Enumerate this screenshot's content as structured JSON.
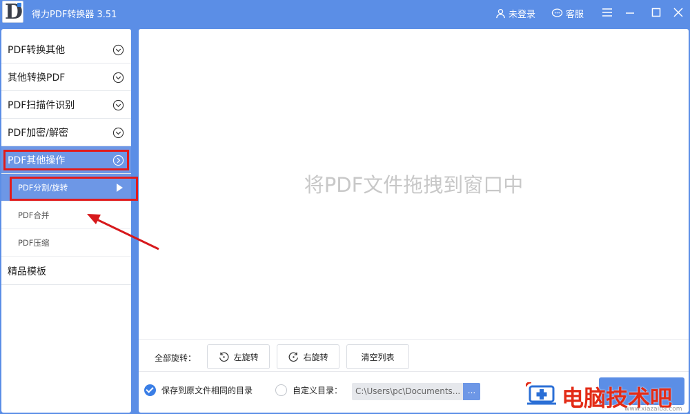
{
  "window": {
    "title": "得力PDF转换器 3.51",
    "login_label": "未登录",
    "service_label": "客服"
  },
  "icons": {
    "logo": "app-logo-icon",
    "user": "user-icon",
    "chat": "chat-icon",
    "menu": "hamburger-menu-icon",
    "minimize": "minimize-icon",
    "maximize": "maximize-icon",
    "close": "close-icon"
  },
  "sidebar": {
    "items": [
      {
        "label": "PDF转换其他"
      },
      {
        "label": "其他转换PDF"
      },
      {
        "label": "PDF扫描件识别"
      },
      {
        "label": "PDF加密/解密"
      },
      {
        "label": "PDF其他操作"
      },
      {
        "label": "精品模板"
      }
    ],
    "sub_items": [
      {
        "label": "PDF分割/旋转"
      },
      {
        "label": "PDF合并"
      },
      {
        "label": "PDF压缩"
      }
    ]
  },
  "main": {
    "drop_hint": "将PDF文件拖拽到窗口中"
  },
  "toolbar": {
    "rotate_all_label": "全部旋转：",
    "rotate_left": "左旋转",
    "rotate_right": "右旋转",
    "clear_list": "清空列表"
  },
  "options": {
    "save_same_dir": "保存到原文件相同的目录",
    "custom_dir": "自定义目录：",
    "path_value": "C:\\Users\\pc\\Documents...",
    "browse": "..."
  },
  "watermark": {
    "text": "电脑技术吧",
    "url": "www.xiazaiba.com"
  },
  "colors": {
    "brand": "#5b8ee6",
    "active": "#6d97e6",
    "highlight": "#e11b1b"
  }
}
